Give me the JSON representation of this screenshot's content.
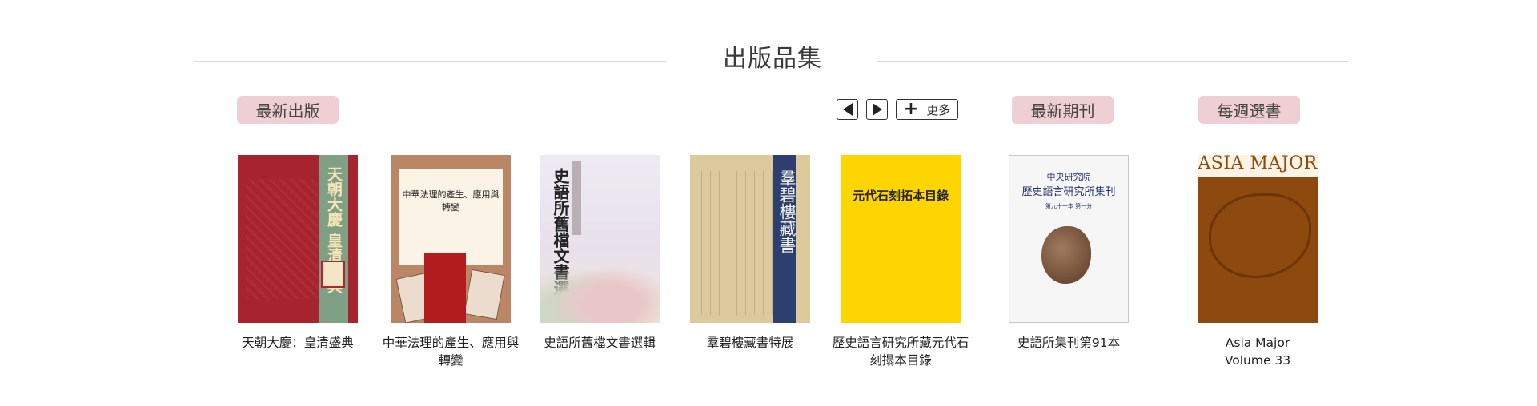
{
  "section": {
    "title": "出版品集"
  },
  "tabs": {
    "latest": "最新出版",
    "journals": "最新期刊",
    "weekly": "每週選書"
  },
  "controls": {
    "more": "更多"
  },
  "books": [
    {
      "caption": "天朝大慶：皇清盛典",
      "cover_title": "天朝大慶 皇清盛典",
      "cover_color": "#a7232d"
    },
    {
      "caption": "中華法理的產生、應用與轉變",
      "cover_title": "中華法理的產生、應用與轉變",
      "cover_color": "#bb8665"
    },
    {
      "caption": "史語所舊檔文書選輯",
      "cover_title": "史語所舊檔文書選輯",
      "cover_color": "#eeeaf2"
    },
    {
      "caption": "羣碧樓藏書特展",
      "cover_title": "羣碧樓藏書",
      "cover_color": "#dcc99c"
    },
    {
      "caption": "歷史語言研究所藏元代石刻搨本目錄",
      "cover_title": "元代石刻拓本目錄",
      "cover_color": "#ffd500"
    }
  ],
  "journals": [
    {
      "caption": "史語所集刊第91本",
      "cover_org": "中央研究院",
      "cover_title": "歷史語言研究所集刊",
      "cover_issue": "第九十一本 第一分",
      "cover_color": "#f6f6f6"
    }
  ],
  "weekly": [
    {
      "caption_line1": "Asia Major",
      "caption_line2": "Volume 33",
      "cover_title": "ASIA MAJOR",
      "cover_color": "#8e4a0e"
    }
  ]
}
